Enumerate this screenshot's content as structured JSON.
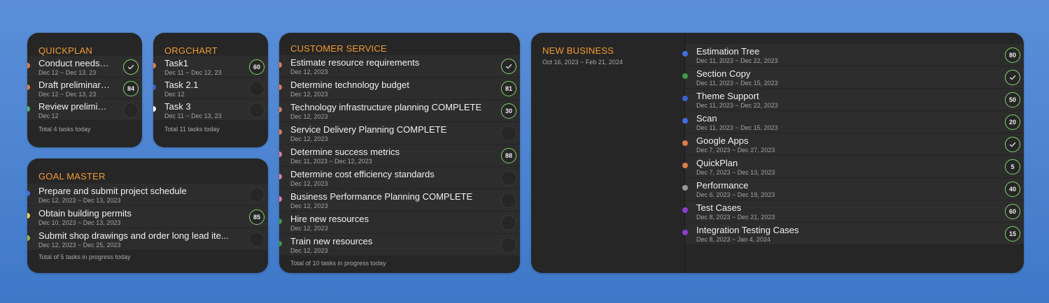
{
  "quickplan": {
    "title": "QUICKPLAN",
    "rows": [
      {
        "name": "Conduct needs an...",
        "dates": "Dec 12 ~ Dec 13, 23",
        "status": "done",
        "dot": "#e07a4a"
      },
      {
        "name": "Draft preliminary...",
        "dates": "Dec 12 ~ Dec 13, 23",
        "status": "progress",
        "pct": "84",
        "dot": "#e07a4a"
      },
      {
        "name": "Review preliminar...",
        "dates": "Dec 12",
        "status": "empty",
        "dot": "#4caf7a"
      }
    ],
    "footer": "Total 4 tasks today"
  },
  "orgchart": {
    "title": "ORGCHART",
    "rows": [
      {
        "name": "Task1",
        "dates": "Dec 11 ~ Dec 12, 23",
        "status": "progress",
        "pct": "60",
        "dot": "#e07a4a"
      },
      {
        "name": "Task 2.1",
        "dates": "Dec 12",
        "status": "empty",
        "dot": "#3f5fd0"
      },
      {
        "name": "Task 3",
        "dates": "Dec 11 ~ Dec 13, 23",
        "status": "empty",
        "dot": "#f2f2f2"
      }
    ],
    "footer": "Total 11 tasks today"
  },
  "goalmaster": {
    "title": "GOAL MASTER",
    "rows": [
      {
        "name": "Prepare and submit project schedule",
        "dates": "Dec 12, 2023 ~ Dec 13, 2023",
        "status": "empty",
        "dot": "#3f6fe0"
      },
      {
        "name": "Obtain building permits",
        "dates": "Dec 10, 2023 ~ Dec 13, 2023",
        "status": "progress",
        "pct": "85",
        "dot": "#e8d84a"
      },
      {
        "name": "Submit shop drawings and order long lead ite...",
        "dates": "Dec 12, 2023 ~ Dec 25, 2023",
        "status": "empty",
        "dot": "#9fb04a"
      }
    ],
    "footer": "Total of 5 tasks in progress today"
  },
  "customer": {
    "title": "CUSTOMER SERVICE",
    "rows": [
      {
        "name": "Estimate resource requirements",
        "dates": "Dec 12, 2023",
        "status": "done",
        "dot": "#e07a4a"
      },
      {
        "name": "Determine technology budget",
        "dates": "Dec 12, 2023",
        "status": "progress",
        "pct": "81",
        "dot": "#e07a4a"
      },
      {
        "name": "Technology infrastructure planning COMPLETE",
        "dates": "Dec 12, 2023",
        "status": "progress",
        "pct": "30",
        "dot": "#e07a4a"
      },
      {
        "name": "Service Delivery Planning COMPLETE",
        "dates": "Dec 12, 2023",
        "status": "empty",
        "dot": "#e07a4a"
      },
      {
        "name": "Determine success metrics",
        "dates": "Dec 11, 2023 ~ Dec 12, 2023",
        "status": "progress",
        "pct": "88",
        "dot": "#e07aa8"
      },
      {
        "name": "Determine cost efficiency standards",
        "dates": "Dec 12, 2023",
        "status": "empty",
        "dot": "#e07aa8"
      },
      {
        "name": "Business Performance Planning COMPLETE",
        "dates": "Dec 12, 2023",
        "status": "empty",
        "dot": "#e07aa8"
      },
      {
        "name": "Hire new resources",
        "dates": "Dec 12, 2023",
        "status": "empty",
        "dot": "#3f9a4a"
      },
      {
        "name": "Train new resources",
        "dates": "Dec 12, 2023",
        "status": "empty",
        "dot": "#3f9a4a"
      }
    ],
    "footer": "Total of 10 tasks in progress today"
  },
  "newbusiness": {
    "title": "NEW BUSINESS",
    "dates": "Oct 16, 2023 ~ Feb 21, 2024",
    "rows": [
      {
        "name": "Estimation Tree",
        "dates": "Dec 11, 2023 ~ Dec 22, 2023",
        "status": "progress",
        "pct": "80",
        "dot": "#3f6fe0"
      },
      {
        "name": "Section Copy",
        "dates": "Dec 11, 2023 ~ Dec 15, 2023",
        "status": "done",
        "dot": "#3f9a4a"
      },
      {
        "name": "Theme Support",
        "dates": "Dec 11, 2023 ~ Dec 22, 2023",
        "status": "progress",
        "pct": "50",
        "dot": "#3f5fd0"
      },
      {
        "name": "Scan",
        "dates": "Dec 11, 2023 ~ Dec 15, 2023",
        "status": "progress",
        "pct": "20",
        "dot": "#3f6fe0"
      },
      {
        "name": "Google Apps",
        "dates": "Dec 7, 2023 ~ Dec 27, 2023",
        "status": "done",
        "dot": "#e07a4a"
      },
      {
        "name": "QuickPlan",
        "dates": "Dec 7, 2023 ~ Dec 13, 2023",
        "status": "progress",
        "pct": "5",
        "dot": "#e07a4a"
      },
      {
        "name": "Performance",
        "dates": "Dec 6, 2023 ~ Dec 19, 2023",
        "status": "progress",
        "pct": "40",
        "dot": "#9a9a9a"
      },
      {
        "name": "Test Cases",
        "dates": "Dec 8, 2023 ~ Dec 21, 2023",
        "status": "progress",
        "pct": "60",
        "dot": "#8a3fd0"
      },
      {
        "name": "Integration Testing Cases",
        "dates": "Dec 8, 2023 ~ Jan 4, 2024",
        "status": "progress",
        "pct": "15",
        "dot": "#8a3fd0"
      }
    ]
  }
}
